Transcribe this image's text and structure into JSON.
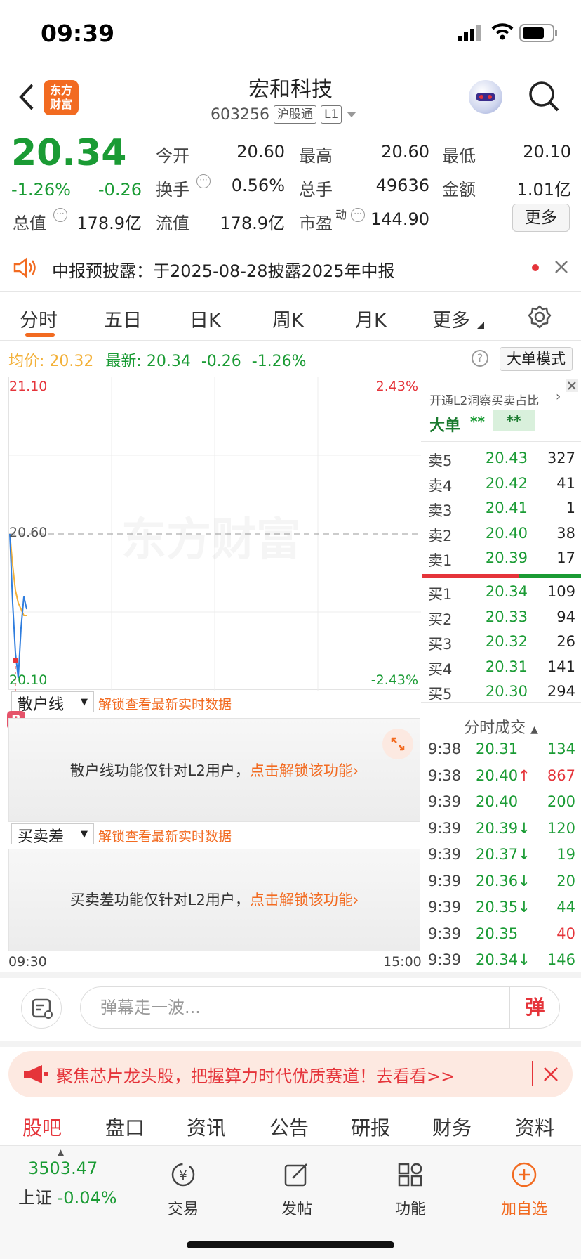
{
  "status": {
    "time": "09:39"
  },
  "header": {
    "title": "宏和科技",
    "code": "603256",
    "tag1": "沪股通",
    "tag2": "L1",
    "logo_line1": "东方",
    "logo_line2": "财富"
  },
  "quote": {
    "price": "20.34",
    "pct": "-1.26%",
    "chg": "-0.26",
    "open_label": "今开",
    "open": "20.60",
    "high_label": "最高",
    "high": "20.60",
    "low_label": "最低",
    "low": "20.10",
    "turnover_label": "换手",
    "turnover": "0.56%",
    "volume_label": "总手",
    "volume": "49636",
    "amount_label": "金额",
    "amount": "1.01亿",
    "mcap_label": "总值",
    "mcap": "178.9亿",
    "float_label": "流值",
    "float": "178.9亿",
    "pe_label": "市盈",
    "pe_sup": "动",
    "pe": "144.90",
    "more": "更多"
  },
  "notice": {
    "text": "中报预披露：于2025-08-28披露2025年中报"
  },
  "tabs": [
    "分时",
    "五日",
    "日K",
    "周K",
    "月K",
    "更多"
  ],
  "info": {
    "avg_label": "均价:",
    "avg": "20.32",
    "latest_label": "最新:",
    "latest": "20.34",
    "chg": "-0.26",
    "pct": "-1.26%",
    "mode_btn": "大单模式"
  },
  "chart": {
    "y_top": "21.10",
    "y_mid": "20.60",
    "y_bottom": "20.10",
    "pct_top": "2.43%",
    "pct_bottom": "-2.43%",
    "watermark": "东方财富",
    "x_start": "09:30",
    "x_end": "15:00"
  },
  "chart_data": {
    "type": "line",
    "xlabel": "",
    "ylabel": "",
    "ylim": [
      20.1,
      21.1
    ],
    "series": [
      {
        "values": [
          20.6,
          20.38,
          20.22,
          20.14,
          20.3,
          20.4,
          20.36
        ]
      },
      {
        "values": [
          20.6,
          20.5,
          20.42,
          20.38,
          20.36,
          20.34,
          20.34
        ]
      }
    ]
  },
  "l2": {
    "promo": "开通L2洞察买卖占比",
    "big_label": "大单",
    "big_v1": "**",
    "big_v2": "**"
  },
  "asks": [
    {
      "label": "卖5",
      "price": "20.43",
      "vol": "327"
    },
    {
      "label": "卖4",
      "price": "20.42",
      "vol": "41"
    },
    {
      "label": "卖3",
      "price": "20.41",
      "vol": "1"
    },
    {
      "label": "卖2",
      "price": "20.40",
      "vol": "38"
    },
    {
      "label": "卖1",
      "price": "20.39",
      "vol": "17"
    }
  ],
  "bids": [
    {
      "label": "买1",
      "price": "20.34",
      "vol": "109"
    },
    {
      "label": "买2",
      "price": "20.33",
      "vol": "94"
    },
    {
      "label": "买3",
      "price": "20.32",
      "vol": "26"
    },
    {
      "label": "买4",
      "price": "20.31",
      "vol": "141"
    },
    {
      "label": "买5",
      "price": "20.30",
      "vol": "294"
    }
  ],
  "trades_title": "分时成交",
  "trades": [
    {
      "time": "9:38",
      "price": "20.31",
      "arrow": "",
      "vol": "134",
      "volcolor": "green"
    },
    {
      "time": "9:38",
      "price": "20.40",
      "arrow": "↑",
      "vol": "867",
      "volcolor": "red"
    },
    {
      "time": "9:39",
      "price": "20.40",
      "arrow": "",
      "vol": "200",
      "volcolor": "green"
    },
    {
      "time": "9:39",
      "price": "20.39",
      "arrow": "↓",
      "vol": "120",
      "volcolor": "green"
    },
    {
      "time": "9:39",
      "price": "20.37",
      "arrow": "↓",
      "vol": "19",
      "volcolor": "green"
    },
    {
      "time": "9:39",
      "price": "20.36",
      "arrow": "↓",
      "vol": "20",
      "volcolor": "green"
    },
    {
      "time": "9:39",
      "price": "20.35",
      "arrow": "↓",
      "vol": "44",
      "volcolor": "green"
    },
    {
      "time": "9:39",
      "price": "20.35",
      "arrow": "",
      "vol": "40",
      "volcolor": "red"
    },
    {
      "time": "9:39",
      "price": "20.34",
      "arrow": "↓",
      "vol": "146",
      "volcolor": "green"
    }
  ],
  "retail": {
    "select": "散户线",
    "unlock": "解锁查看最新实时数据",
    "msg": "散户线功能仅针对L2用户，",
    "cta": "点击解锁该功能"
  },
  "spread": {
    "select": "买卖差",
    "unlock": "解锁查看最新实时数据",
    "msg": "买卖差功能仅针对L2用户，",
    "cta": "点击解锁该功能"
  },
  "comment": {
    "placeholder": "弹幕走一波...",
    "send": "弹"
  },
  "banner": {
    "text": "聚焦芯片龙头股，把握算力时代优质赛道！去看看>>"
  },
  "subtabs": [
    "股吧",
    "盘口",
    "资讯",
    "公告",
    "研报",
    "财务",
    "资料"
  ],
  "index": {
    "value": "3503.47",
    "name": "上证",
    "pct": "-0.04%"
  },
  "nav": [
    "交易",
    "发帖",
    "功能",
    "加自选"
  ],
  "colors": {
    "up": "#e5343a",
    "down": "#1a9b34",
    "accent": "#f26b21",
    "avg_line": "#f3b13a",
    "price_line": "#2f7dde"
  }
}
